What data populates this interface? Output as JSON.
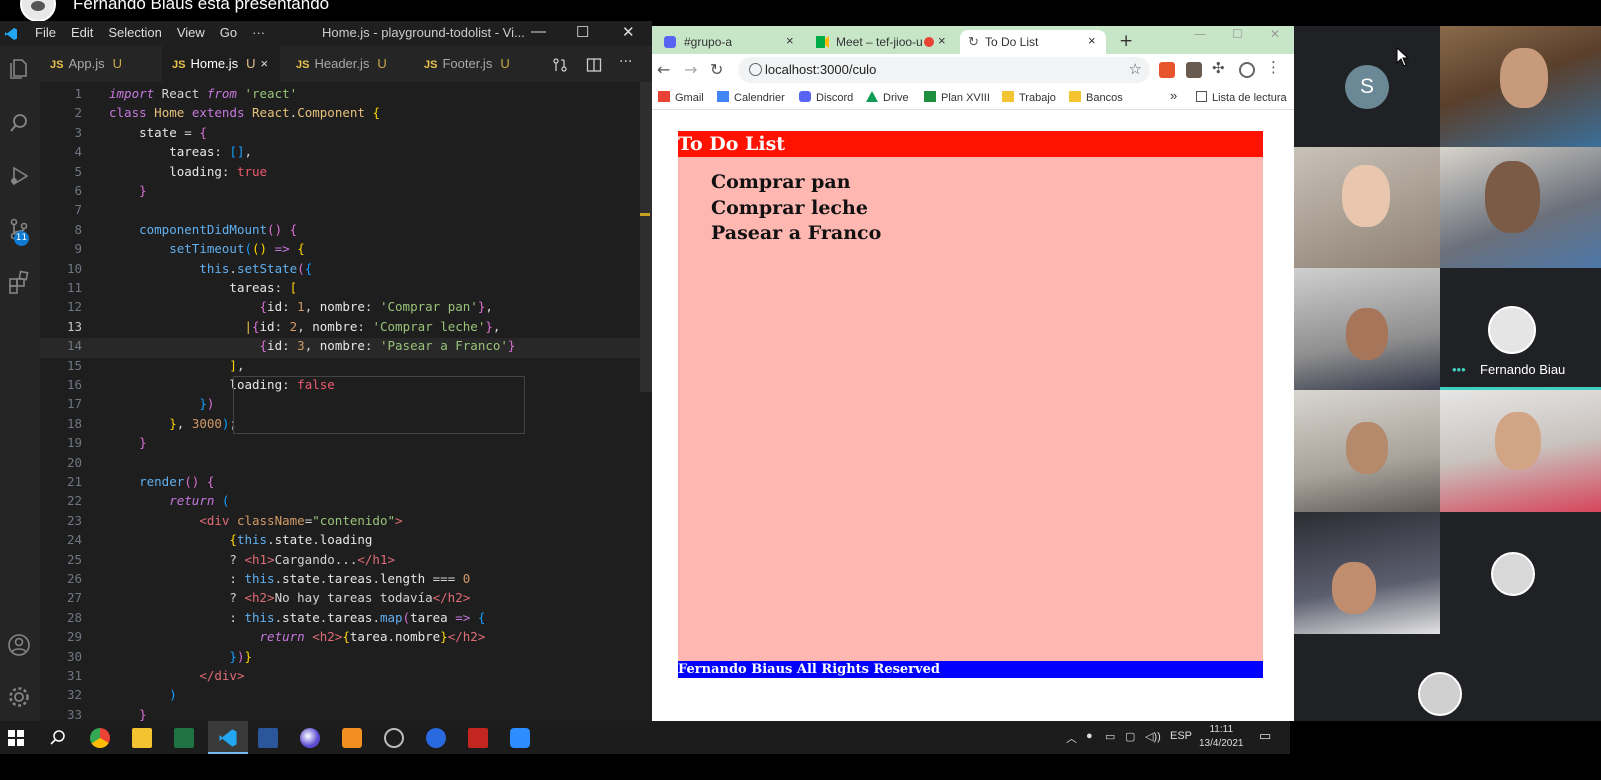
{
  "banner": {
    "title": "Fernando Biaus está presentando"
  },
  "vscode": {
    "menu": [
      "File",
      "Edit",
      "Selection",
      "View",
      "Go"
    ],
    "menu_more": "···",
    "window_title": "Home.js - playground-todolist - Vi...",
    "activity_badge": "11",
    "tabs": [
      {
        "name": "App.js",
        "status": "U"
      },
      {
        "name": "Home.js",
        "status": "U"
      },
      {
        "name": "Header.js",
        "status": "U"
      },
      {
        "name": "Footer.js",
        "status": "U"
      }
    ],
    "js_label": "JS",
    "close_glyph": "×"
  },
  "code_lines": [
    "1",
    "2",
    "3",
    "4",
    "5",
    "6",
    "7",
    "8",
    "9",
    "10",
    "11",
    "12",
    "13",
    "14",
    "15",
    "16",
    "17",
    "18",
    "19",
    "20",
    "21",
    "22",
    "23",
    "24",
    "25",
    "26",
    "27",
    "28",
    "29",
    "30",
    "31",
    "32",
    "33"
  ],
  "chrome": {
    "tabs": [
      {
        "title": "#grupo-a",
        "color": "#5865f2"
      },
      {
        "title": "Meet – tef-jioo-u",
        "color": "#1a73e8"
      },
      {
        "title": "To Do List",
        "color": "#777777"
      }
    ],
    "url": "localhost:3000/culo",
    "bookmarks": [
      "Gmail",
      "Calendrier",
      "Discord",
      "Drive",
      "Plan XVIII",
      "Trabajo",
      "Bancos"
    ],
    "bookmarks_more": "»",
    "reading_list": "Lista de lectura"
  },
  "todo": {
    "header": "To Do List",
    "items": [
      "Comprar pan",
      "Comprar leche",
      "Pasear a Franco"
    ],
    "footer": "Fernando Biaus All Rights Reserved",
    "header_color": "#fe1200",
    "body_color": "#ffb7b2",
    "footer_color": "#0000ff"
  },
  "meet": {
    "s_avatar_letter": "S",
    "presenter_name": "Fernando Biau",
    "presenter_dots": "•••"
  },
  "taskbar": {
    "language": "ESP",
    "time": "11:11",
    "date": "13/4/2021"
  }
}
